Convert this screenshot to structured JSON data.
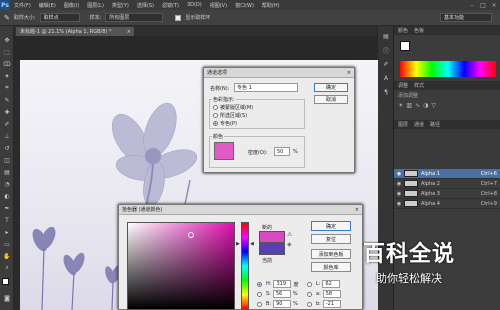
{
  "app": {
    "logo": "Ps"
  },
  "menu": [
    "文件(F)",
    "编辑(E)",
    "图像(I)",
    "图层(L)",
    "类型(Y)",
    "选择(S)",
    "滤镜(T)",
    "3D(D)",
    "视图(V)",
    "窗口(W)",
    "帮助(H)"
  ],
  "options": {
    "size_label": "取样大小:",
    "size_value": "取样点",
    "sample_label": "样本:",
    "sample_value": "所有图层",
    "show_ring": "显示取样环",
    "workspace": "基本功能"
  },
  "document_tab": {
    "title": "未标题-1 @ 21.1% (Alpha 1, RGB/8) *",
    "close": "×"
  },
  "channels_panel": {
    "header": [
      "图层",
      "通道",
      "路径"
    ],
    "rows": [
      {
        "name": "Alpha 1",
        "shortcut": "Ctrl+6",
        "selected": true
      },
      {
        "name": "Alpha 2",
        "shortcut": "Ctrl+7",
        "selected": false
      },
      {
        "name": "Alpha 3",
        "shortcut": "Ctrl+8",
        "selected": false
      },
      {
        "name": "Alpha 4",
        "shortcut": "Ctrl+9",
        "selected": false
      }
    ]
  },
  "color_panel": {
    "header": [
      "颜色",
      "色板"
    ]
  },
  "adjust_panel": {
    "header": [
      "调整",
      "样式"
    ],
    "hint": "添加调整"
  },
  "channel_options": {
    "title": "通道选项",
    "name_label": "名称(N):",
    "name_value": "专色 1",
    "ok": "确定",
    "cancel": "取消",
    "indicates_label": "色彩指示:",
    "radio": [
      "被蒙版区域(M)",
      "所选区域(S)",
      "专色(P)"
    ],
    "color_label": "颜色",
    "solidity_label": "密度(O):",
    "solidity_value": "50",
    "percent": "%"
  },
  "color_picker": {
    "title": "拾色器 (通道颜色)",
    "new_label": "新的",
    "current_label": "当前",
    "ok": "确定",
    "cancel": "复位",
    "add_swatch": "添加到色板",
    "libraries": "颜色库",
    "h_label": "H:",
    "h_value": "319",
    "h_unit": "度",
    "s_label": "S:",
    "s_value": "56",
    "s_unit": "%",
    "b_label": "B:",
    "b_value": "90",
    "b_unit": "%",
    "l_label": "L:",
    "l_value": "62",
    "a_label": "a:",
    "a_value": "58",
    "b2_label": "b:",
    "b2_value": "-21"
  },
  "watermark": {
    "title": "百科全说",
    "subtitle": "助你轻松解决"
  },
  "colors": {
    "spot": "#e25bc4",
    "new_color": "#d948c0",
    "current_color": "#5a3fb2"
  }
}
